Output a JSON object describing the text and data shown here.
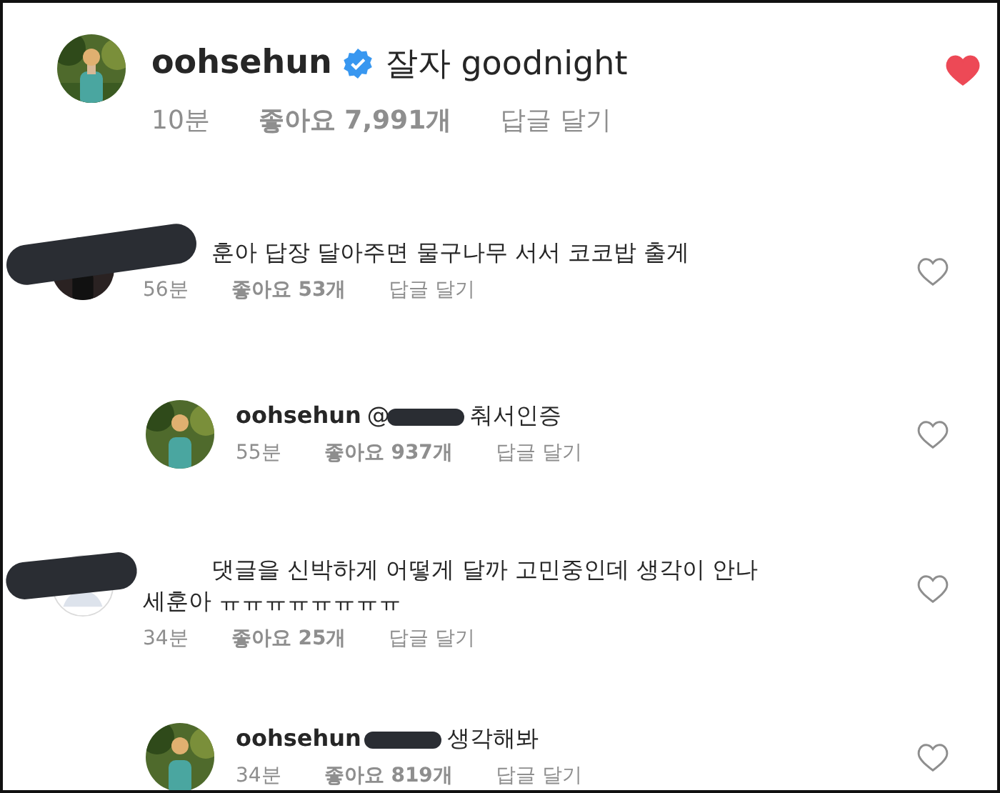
{
  "post": {
    "username": "oohsehun",
    "verified": true,
    "caption": "잘자 goodnight",
    "time": "10분",
    "likes": "좋아요 7,991개",
    "reply": "답글 달기",
    "liked": true
  },
  "comments": [
    {
      "kind": "comment",
      "redacted": true,
      "text": "훈아 답장 달아주면 물구나무 서서 코코밥 출게",
      "time": "56분",
      "likes": "좋아요 53개",
      "reply": "답글 달기",
      "liked": false
    },
    {
      "kind": "reply",
      "username": "oohsehun",
      "mention": "@",
      "redacted": true,
      "text": "춰서인증",
      "time": "55분",
      "likes": "좋아요 937개",
      "reply": "답글 달기",
      "liked": false
    },
    {
      "kind": "comment",
      "avatar": {
        "kind": "default"
      },
      "redacted": true,
      "text": "댓글을 신박하게 어떻게 달까 고민중인데 생각이 안나 세훈아 ㅠㅠㅠㅠㅠㅠㅠㅠ",
      "time": "34분",
      "likes": "좋아요 25개",
      "reply": "답글 달기",
      "liked": false
    },
    {
      "kind": "reply",
      "username": "oohsehun",
      "redacted": true,
      "text": "생각해봐",
      "time": "34분",
      "likes": "좋아요 819개",
      "reply": "답글 달기",
      "liked": false
    }
  ]
}
